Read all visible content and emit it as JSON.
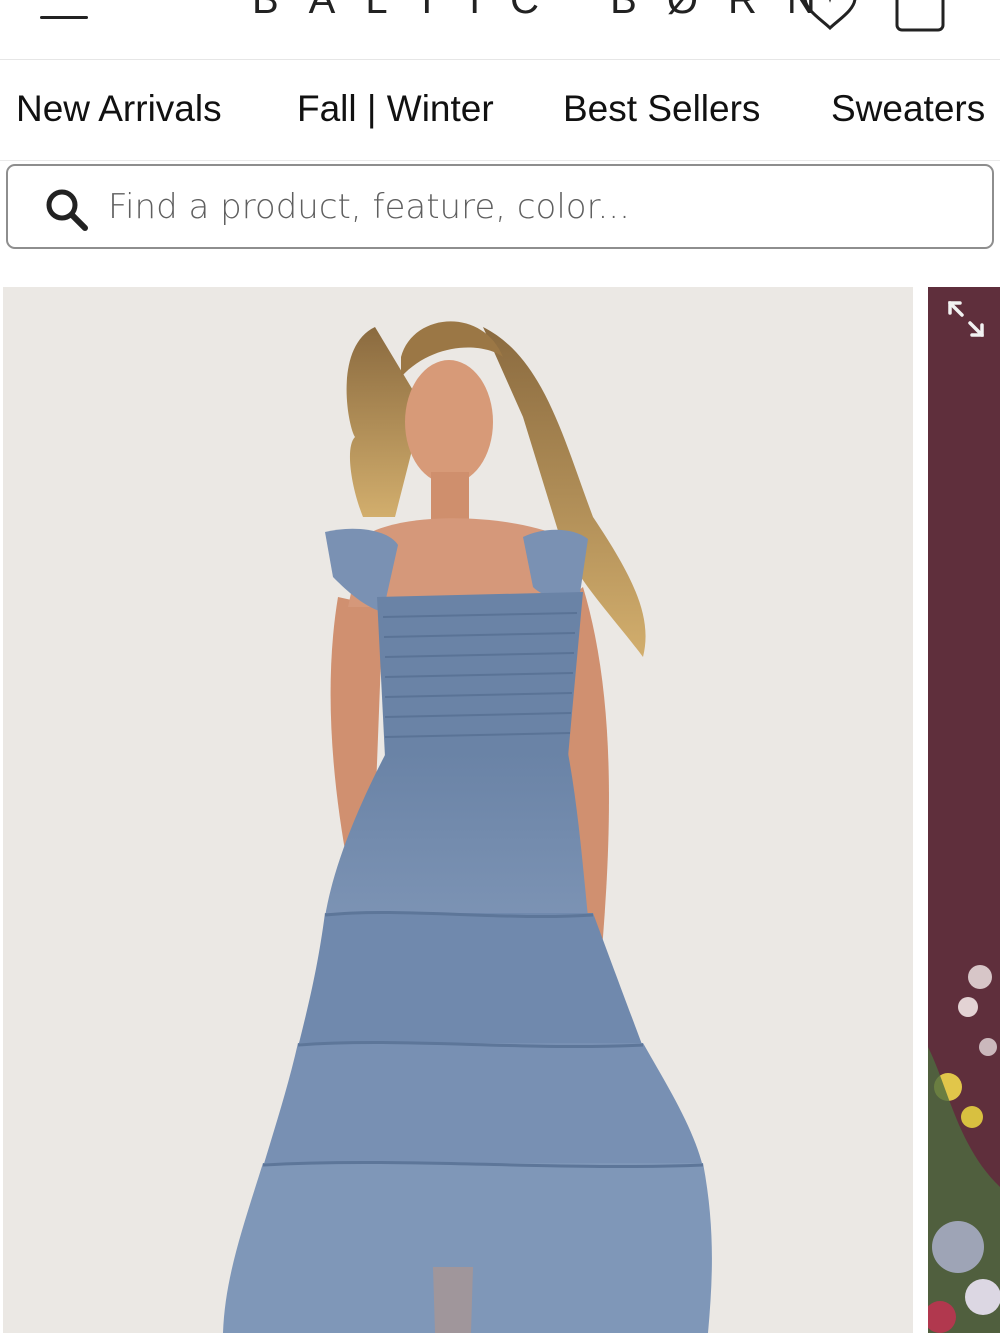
{
  "header": {
    "logo": "BALTIC BØRN",
    "menu_icon": "hamburger-icon",
    "wishlist_icon": "heart-icon",
    "cart_icon": "bag-icon"
  },
  "nav": {
    "items": [
      {
        "label": "New Arrivals"
      },
      {
        "label": "Fall | Winter"
      },
      {
        "label": "Best Sellers"
      },
      {
        "label": "Sweaters"
      }
    ]
  },
  "search": {
    "placeholder": "Find a product, feature, color...",
    "icon": "search-icon"
  },
  "products": {
    "main_image_alt": "Model wearing a dusty blue smocked tiered tulle midi dress with ruffle straps",
    "side_expand_icon": "expand-icon",
    "colors": {
      "main_bg": "#ebe8e4",
      "dress": "#6f88ab",
      "side_bg": "#5f2f3c"
    }
  }
}
